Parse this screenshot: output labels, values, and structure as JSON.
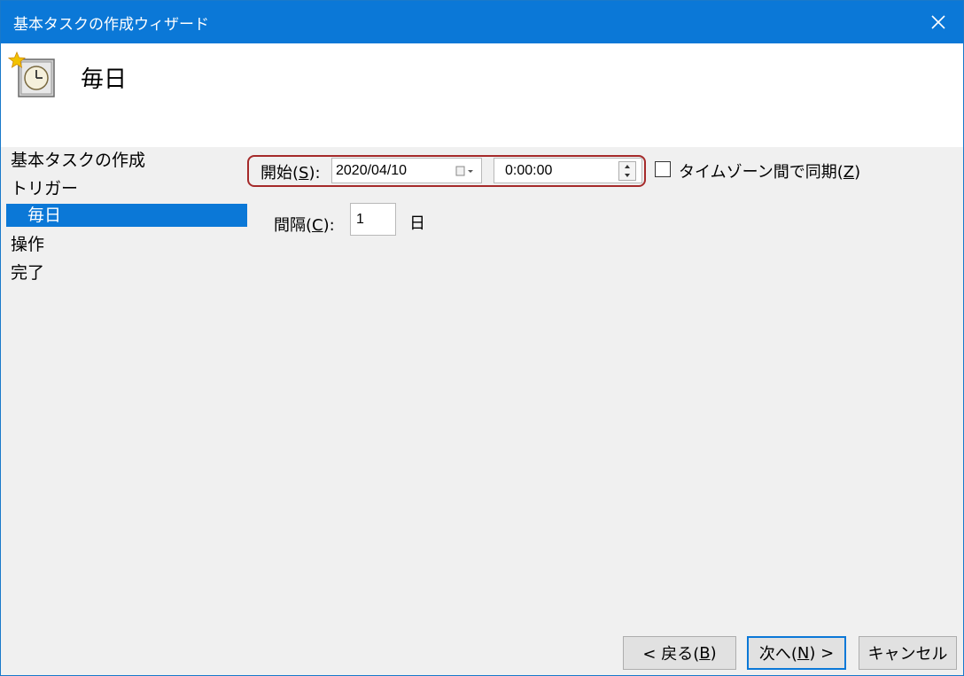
{
  "window": {
    "title": "基本タスクの作成ウィザード"
  },
  "header": {
    "title": "毎日",
    "icon": "clock-task-icon"
  },
  "sidebar": {
    "items": [
      {
        "label": "基本タスクの作成",
        "selected": false
      },
      {
        "label": "トリガー",
        "selected": false
      },
      {
        "label": "毎日",
        "selected": true
      },
      {
        "label": "操作",
        "selected": false
      },
      {
        "label": "完了",
        "selected": false
      }
    ]
  },
  "start": {
    "label": "開始(",
    "mnemonic": "S",
    "label_suffix": "):",
    "date": "2020/04/10",
    "time": "0:00:00"
  },
  "sync_timezone": {
    "label": "タイムゾーン間で同期(",
    "mnemonic": "Z",
    "label_suffix": ")",
    "checked": false
  },
  "interval": {
    "label": "間隔(",
    "mnemonic": "C",
    "label_suffix": "):",
    "value": "1",
    "unit": "日"
  },
  "buttons": {
    "back": {
      "prefix": "< 戻る(",
      "mnemonic": "B",
      "suffix": ")"
    },
    "next": {
      "prefix": "次へ(",
      "mnemonic": "N",
      "suffix": ") >"
    },
    "cancel": {
      "label": "キャンセル"
    }
  },
  "colors": {
    "accent": "#0b78d7",
    "highlight_border": "#a52a2a"
  }
}
